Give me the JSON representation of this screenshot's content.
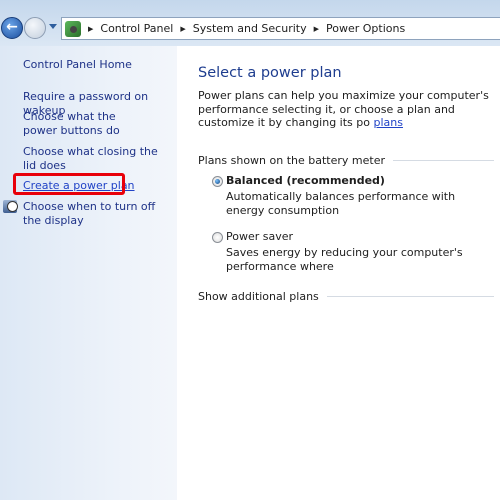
{
  "address_bar": {
    "breadcrumb": [
      "Control Panel",
      "System and Security",
      "Power Options"
    ]
  },
  "sidebar": {
    "home": "Control Panel Home",
    "items": [
      {
        "label": "Require a password on wakeup"
      },
      {
        "label": "Choose what the power buttons do"
      },
      {
        "label": "Choose what closing the lid does"
      },
      {
        "label": "Create a power plan",
        "highlighted": true
      },
      {
        "label": "Choose when to turn off the display"
      }
    ]
  },
  "main": {
    "title": "Select a power plan",
    "description_line1": "Power plans can help you maximize your computer's performance",
    "description_line2": "selecting it, or choose a plan and customize it by changing its po",
    "description_link": "plans",
    "group_label": "Plans shown on the battery meter",
    "plans": [
      {
        "name": "Balanced (recommended)",
        "selected": true,
        "description": "Automatically balances performance with energy consumption"
      },
      {
        "name": "Power saver",
        "selected": false,
        "description": "Saves energy by reducing your computer's performance where"
      }
    ],
    "show_more": "Show additional plans"
  },
  "colors": {
    "highlight": "#e8000a",
    "link": "#2143c7",
    "heading": "#1e3d8f"
  }
}
